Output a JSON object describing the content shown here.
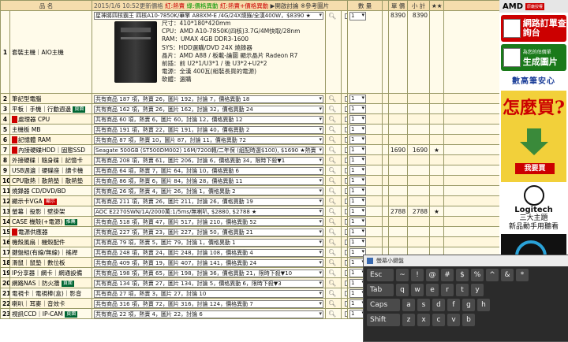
{
  "header": {
    "col_name": "品 名",
    "timestamp": "2015/1/6 10:52更新價格",
    "legend_red": "紅:熱賣",
    "legend_green": "綠:價格異動",
    "legend_mix": "紅:熱賣+價格異動",
    "open_compare": "開啟討論",
    "ref_photo": "參考圖片",
    "col_qty": "數 量",
    "col_price": "單 價",
    "col_subtotal": "小 計",
    "col_star": "★★"
  },
  "pc_row": {
    "num": "1",
    "category": "套裝主機｜AIO主機",
    "selected": "星神將四核霸王 四核A10-7850K/華擎 A88XM-E /4G/24X燒錄/全漢400W，$8390 ★",
    "specs": "尺寸：410*180*420mm\nCPU：AMD A10-7850K(四核)3.7G/4M快取/28nm\nRAM：UMAX 4GB DDR3-1600\nSYS：HDD選購/DVD 24X 燒錄器\n晶片：AMD A88 / 板載-論圖 顯示晶片 Radeon R7\n前插：前 U2*1/U3*1 / 後 U3*2+U2*2\n電源：全漢 400瓦(組裝長買的電源)\n軟體：選購",
    "qty": "1",
    "price": "8390",
    "subtotal": "8390"
  },
  "rows": [
    {
      "num": "2",
      "cat": "筆記型電腦",
      "badge": "",
      "tag": "",
      "sel": "共有商品 187 項，熱賣 26，圖片 192，討論 7，價格異動 18",
      "price": "",
      "subtotal": "",
      "star": ""
    },
    {
      "num": "3",
      "cat": "平板｜手機｜行動週邊",
      "badge": "",
      "tag": "頁面",
      "sel": "共有商品 162 項，熱賣 26，圖片 162，討論 32，價格異動 24",
      "price": "",
      "subtotal": "",
      "star": ""
    },
    {
      "num": "4",
      "cat": "處理器 CPU",
      "badge": "red",
      "tag": "",
      "sel": "共有商品 60 項，熱賣 6，圖片 60，討論 12，價格異動 12",
      "price": "",
      "subtotal": "",
      "star": ""
    },
    {
      "num": "5",
      "cat": "主機板 MB",
      "badge": "",
      "tag": "",
      "sel": "共有商品 191 項，熱賣 22，圖片 191，討論 40，價格異動 2",
      "price": "",
      "subtotal": "",
      "star": ""
    },
    {
      "num": "6",
      "cat": "記憶體 RAM",
      "badge": "red",
      "tag": "",
      "sel": "共有商品 87 項，熱賣 10，圖片 87，討論 11，價格異動 72",
      "price": "",
      "subtotal": "",
      "star": ""
    },
    {
      "num": "7",
      "cat": "內接硬碟HDD｜固態SSD",
      "badge": "red",
      "tag": "",
      "sel": "Seagate 500GB (ST500DM002) 16M/7200轉/二年保 (組配時選$100), $1690 ★熱賣",
      "price": "1690",
      "subtotal": "1690",
      "star": "★"
    },
    {
      "num": "8",
      "cat": "外接硬碟｜隨身碟｜記憶卡",
      "badge": "",
      "tag": "",
      "sel": "共有商品 208 項，熱賣 61，圖片 206，討論 6，價格異動 34，限時下殺▼1",
      "price": "",
      "subtotal": "",
      "star": ""
    },
    {
      "num": "9",
      "cat": "USB週邊｜硬碟座｜讀卡機",
      "badge": "",
      "tag": "",
      "sel": "共有商品 64 項，熱賣 7，圖片 64，討論 10，價格異動 6",
      "price": "",
      "subtotal": "",
      "star": ""
    },
    {
      "num": "10",
      "cat": "CPU散熱｜散熱墊｜散熱墊",
      "badge": "",
      "tag": "",
      "sel": "共有商品 86 項，熱賣 6，圖片 84，討論 28，價格異動 11",
      "price": "",
      "subtotal": "",
      "star": ""
    },
    {
      "num": "11",
      "cat": "燒錄器 CD/DVD/BD",
      "badge": "",
      "tag": "",
      "sel": "共有商品 26 項，熱賣 4，圖片 26，討論 1，價格異動 2",
      "price": "",
      "subtotal": "",
      "star": ""
    },
    {
      "num": "12",
      "cat": "顯示卡VGA",
      "badge": "",
      "tag": "顯示",
      "tagred": true,
      "sel": "共有商品 211 項，熱賣 26，圖片 211，討論 26，價格異動 19",
      "price": "",
      "subtotal": "",
      "star": ""
    },
    {
      "num": "13",
      "cat": "螢幕｜投影｜壁掛架",
      "badge": "",
      "tag": "",
      "sel": "AOC E2270SWN/1A/2000萬:1/5ms/無喇叭, $2880, $2788 ★",
      "price": "2788",
      "subtotal": "2788",
      "star": "★"
    },
    {
      "num": "14",
      "cat": "CASE 機殼(+電源)",
      "badge": "",
      "tag": "推薦",
      "sel": "共有商品 518 項，熱賣 47，圖片 517，討論 210，價格異動 52",
      "price": "",
      "subtotal": "",
      "star": ""
    },
    {
      "num": "15",
      "cat": "電源供應器",
      "badge": "red",
      "tag": "",
      "sel": "共有商品 227 項，熱賣 23，圖片 227，討論 50，價格異動 21",
      "price": "",
      "subtotal": "",
      "star": ""
    },
    {
      "num": "16",
      "cat": "機殼風扇｜機殼配件",
      "badge": "",
      "tag": "",
      "sel": "共有商品 79 項，熱賣 5，圖片 79，討論 1，價格異動 1",
      "price": "",
      "subtotal": "",
      "star": ""
    },
    {
      "num": "17",
      "cat": "鍵盤組(有線/無線)｜搖桿",
      "badge": "",
      "tag": "",
      "sel": "共有商品 248 項，熱賣 24，圖片 248，討論 108，價格異動 4",
      "price": "",
      "subtotal": "",
      "star": ""
    },
    {
      "num": "18",
      "cat": "滑鼠｜鼠墊｜數位板",
      "badge": "",
      "tag": "",
      "sel": "共有商品 409 項，熱賣 19，圖片 407，討論 141，價格異動 24",
      "price": "",
      "subtotal": "",
      "star": ""
    },
    {
      "num": "19",
      "cat": "IP分享器｜網卡｜網通設備",
      "badge": "",
      "tag": "",
      "sel": "共有商品 198 項，熱賣 65，圖片 198，討論 36，價格異動 21，限時下殺▼10",
      "price": "",
      "subtotal": "",
      "star": ""
    },
    {
      "num": "20",
      "cat": "網路NAS｜防火牆",
      "badge": "",
      "tag": "頁面",
      "sel": "共有商品 134 項，熱賣 27，圖片 134，討論 5，價格異動 6，限時下殺▼3",
      "price": "",
      "subtotal": "",
      "star": ""
    },
    {
      "num": "21",
      "cat": "電視卡｜電視棒(盒)｜影音",
      "badge": "",
      "tag": "",
      "sel": "共有商品 27 項，熱賣 3，圖片 27，討論 10",
      "price": "",
      "subtotal": "",
      "star": ""
    },
    {
      "num": "22",
      "cat": "喇叭｜耳麥｜音效卡",
      "badge": "",
      "tag": "",
      "sel": "共有商品 316 項，熱賣 72，圖片 316，討論 124，價格異動 7",
      "price": "",
      "subtotal": "",
      "star": ""
    },
    {
      "num": "23",
      "cat": "視訊CCD｜IP-CAM",
      "badge": "",
      "tag": "頁面",
      "sel": "共有商品 22 項，熱賣 4，圖片 22，討論 6",
      "price": "",
      "subtotal": "",
      "star": ""
    }
  ],
  "qty_default": "1",
  "sidebar": {
    "amd": "AMD",
    "amd_badge": "原廠授權",
    "btn1": "網路訂單查詢台",
    "btn2_small": "為您的估價單",
    "btn2": "生成圖片",
    "slogan": "數高筆安心",
    "ad_big": "怎麼買?",
    "ad_btn": "我要買",
    "logi_name": "Logitech",
    "logi_l1": "三大主題",
    "logi_l2": "新品動手用聽看"
  },
  "keyboard": {
    "title": "螢幕小鍵盤",
    "row1": [
      "Esc",
      "~",
      "!",
      "@",
      "#",
      "$",
      "%",
      "^",
      "&",
      "*"
    ],
    "row2": [
      "Tab",
      "q",
      "w",
      "e",
      "r",
      "t",
      "y"
    ],
    "row3": [
      "Caps",
      "a",
      "s",
      "d",
      "f",
      "g",
      "h"
    ],
    "row4": [
      "Shift",
      "z",
      "x",
      "c",
      "v",
      "b"
    ]
  }
}
